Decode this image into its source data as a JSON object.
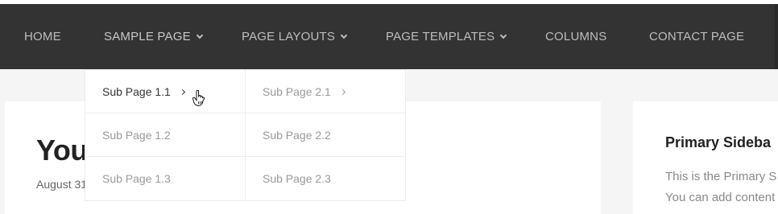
{
  "nav": {
    "items": [
      {
        "label": "HOME",
        "has_submenu": false
      },
      {
        "label": "SAMPLE PAGE",
        "has_submenu": true
      },
      {
        "label": "PAGE LAYOUTS",
        "has_submenu": true
      },
      {
        "label": "PAGE TEMPLATES",
        "has_submenu": true
      },
      {
        "label": "COLUMNS",
        "has_submenu": false
      },
      {
        "label": "CONTACT PAGE",
        "has_submenu": false
      }
    ]
  },
  "dropdown_level1": {
    "items": [
      {
        "label": "Sub Page 1.1",
        "has_submenu": true,
        "hovered": true
      },
      {
        "label": "Sub Page 1.2",
        "has_submenu": false
      },
      {
        "label": "Sub Page 1.3",
        "has_submenu": false
      }
    ]
  },
  "dropdown_level2": {
    "items": [
      {
        "label": "Sub Page 2.1",
        "has_submenu": true
      },
      {
        "label": "Sub Page 2.2",
        "has_submenu": false
      },
      {
        "label": "Sub Page 2.3",
        "has_submenu": false
      }
    ]
  },
  "post": {
    "title_visible": "You",
    "date_visible": "August 31"
  },
  "sidebar": {
    "title": "Primary Sideba",
    "line1": "This is the Primary S",
    "line2": "You can add content"
  },
  "colors": {
    "nav_bg": "#333333",
    "nav_text": "#bdbdbd",
    "page_bg": "#f5f5f5",
    "dropdown_bg": "#ffffff",
    "dropdown_text": "#999999",
    "dropdown_active_text": "#333333"
  },
  "icons": {
    "submenu_indicator": "chevron-down-icon",
    "flyout_indicator": "chevron-right-icon",
    "pointer": "hand-pointer-cursor-icon"
  }
}
